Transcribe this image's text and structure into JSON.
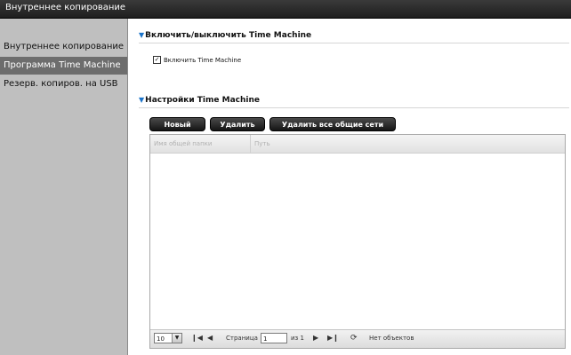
{
  "window": {
    "title": "Внутреннее копирование"
  },
  "sidebar": {
    "items": [
      {
        "label": "Внутреннее копирование"
      },
      {
        "label": "Программа Time Machine"
      },
      {
        "label": "Резерв. копиров. на USB"
      }
    ]
  },
  "section_enable": {
    "title": "Включить/выключить Time Machine",
    "checkbox_label": "Включить Time Machine",
    "checkbox_mark": "✓"
  },
  "section_settings": {
    "title": "Настройки Time Machine",
    "buttons": {
      "new": "Новый",
      "delete": "Удалить",
      "delete_all": "Удалить все общие сети"
    },
    "table": {
      "columns": [
        "Имя общей папки",
        "Путь"
      ],
      "rows": []
    },
    "pager": {
      "page_size": "10",
      "page_label": "Страница",
      "page_value": "1",
      "of_label": "из 1",
      "status": "Нет объектов"
    }
  },
  "colors": {
    "accent": "#1a73c9",
    "active_item": "#6d6d6d",
    "sidebar_bg": "#bfbfbf"
  }
}
